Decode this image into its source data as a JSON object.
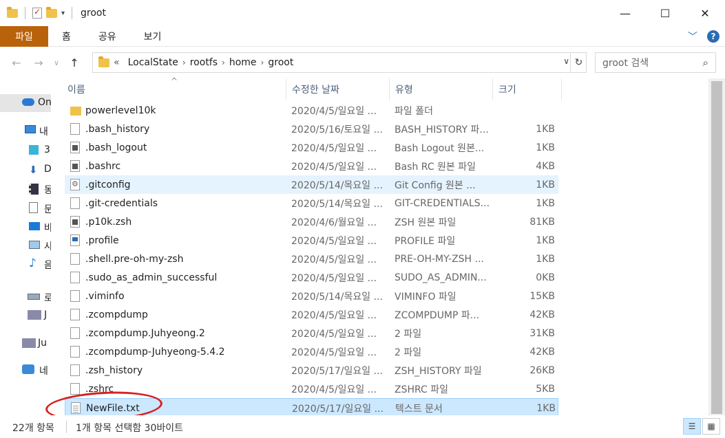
{
  "window": {
    "title": "groot",
    "controls": {
      "minimize": "—",
      "maximize": "☐",
      "close": "✕"
    }
  },
  "ribbon": {
    "file_tab": "파일",
    "tabs": [
      "홈",
      "공유",
      "보기"
    ]
  },
  "address": {
    "prefix": "«",
    "crumbs": [
      "LocalState",
      "rootfs",
      "home",
      "groot"
    ],
    "separator": "›"
  },
  "search": {
    "placeholder": "groot 검색"
  },
  "navpane": {
    "items": [
      {
        "label": "On",
        "icon": "onedrive-icon"
      },
      {
        "label": "내",
        "icon": "this-pc-icon"
      },
      {
        "label": "3",
        "icon": "3d-objects-icon"
      },
      {
        "label": "D",
        "icon": "downloads-icon"
      },
      {
        "label": "동",
        "icon": "videos-icon"
      },
      {
        "label": "문",
        "icon": "documents-icon"
      },
      {
        "label": "바",
        "icon": "desktop-icon"
      },
      {
        "label": "사",
        "icon": "pictures-icon"
      },
      {
        "label": "음",
        "icon": "music-icon"
      },
      {
        "label": "로",
        "icon": "local-disk-icon"
      },
      {
        "label": "J",
        "icon": "sdxc-icon"
      },
      {
        "label": "Ju",
        "icon": "sdxc-icon"
      },
      {
        "label": "네",
        "icon": "network-icon"
      }
    ]
  },
  "columns": {
    "name": "이름",
    "date": "수정한 날짜",
    "type": "유형",
    "size": "크기"
  },
  "files": [
    {
      "name": "powerlevel10k",
      "date": "2020/4/5/일요일 ...",
      "type": "파일 폴더",
      "size": "",
      "icon": "folder-icon"
    },
    {
      "name": ".bash_history",
      "date": "2020/5/16/토요일 ...",
      "type": "BASH_HISTORY 파...",
      "size": "1KB",
      "icon": "file-icon"
    },
    {
      "name": ".bash_logout",
      "date": "2020/4/5/일요일 ...",
      "type": "Bash Logout 원본...",
      "size": "1KB",
      "icon": "script-file-icon"
    },
    {
      "name": ".bashrc",
      "date": "2020/4/5/일요일 ...",
      "type": "Bash RC 원본 파일",
      "size": "4KB",
      "icon": "script-file-icon"
    },
    {
      "name": ".gitconfig",
      "date": "2020/5/14/목요일 ...",
      "type": "Git Config 원본 ...",
      "size": "1KB",
      "icon": "config-file-icon"
    },
    {
      "name": ".git-credentials",
      "date": "2020/5/14/목요일 ...",
      "type": "GIT-CREDENTIALS...",
      "size": "1KB",
      "icon": "file-icon"
    },
    {
      "name": ".p10k.zsh",
      "date": "2020/4/6/월요일 ...",
      "type": "ZSH 원본 파일",
      "size": "81KB",
      "icon": "script-file-icon"
    },
    {
      "name": ".profile",
      "date": "2020/4/5/일요일 ...",
      "type": "PROFILE 파일",
      "size": "1KB",
      "icon": "profile-file-icon"
    },
    {
      "name": ".shell.pre-oh-my-zsh",
      "date": "2020/4/5/일요일 ...",
      "type": "PRE-OH-MY-ZSH ...",
      "size": "1KB",
      "icon": "file-icon"
    },
    {
      "name": ".sudo_as_admin_successful",
      "date": "2020/4/5/일요일 ...",
      "type": "SUDO_AS_ADMIN...",
      "size": "0KB",
      "icon": "file-icon"
    },
    {
      "name": ".viminfo",
      "date": "2020/5/14/목요일 ...",
      "type": "VIMINFO 파일",
      "size": "15KB",
      "icon": "file-icon"
    },
    {
      "name": ".zcompdump",
      "date": "2020/4/5/일요일 ...",
      "type": "ZCOMPDUMP 파...",
      "size": "42KB",
      "icon": "file-icon"
    },
    {
      "name": ".zcompdump.Juhyeong.2",
      "date": "2020/4/5/일요일 ...",
      "type": "2 파일",
      "size": "31KB",
      "icon": "file-icon"
    },
    {
      "name": ".zcompdump-Juhyeong-5.4.2",
      "date": "2020/4/5/일요일 ...",
      "type": "2 파일",
      "size": "42KB",
      "icon": "file-icon"
    },
    {
      "name": ".zsh_history",
      "date": "2020/5/17/일요일 ...",
      "type": "ZSH_HISTORY 파일",
      "size": "26KB",
      "icon": "file-icon"
    },
    {
      "name": ".zshrc",
      "date": "2020/4/5/일요일 ...",
      "type": "ZSHRC 파일",
      "size": "5KB",
      "icon": "file-icon"
    },
    {
      "name": "NewFile.txt",
      "date": "2020/5/17/일요일 ...",
      "type": "텍스트 문서",
      "size": "1KB",
      "icon": "text-file-icon"
    }
  ],
  "status": {
    "count": "22개 항목",
    "selection": "1개 항목 선택함 30바이트"
  },
  "colors": {
    "file_tab": "#b9620a",
    "selected_row": "#cce8ff",
    "hover_row": "#e5f3ff",
    "annotation": "#d82020"
  }
}
